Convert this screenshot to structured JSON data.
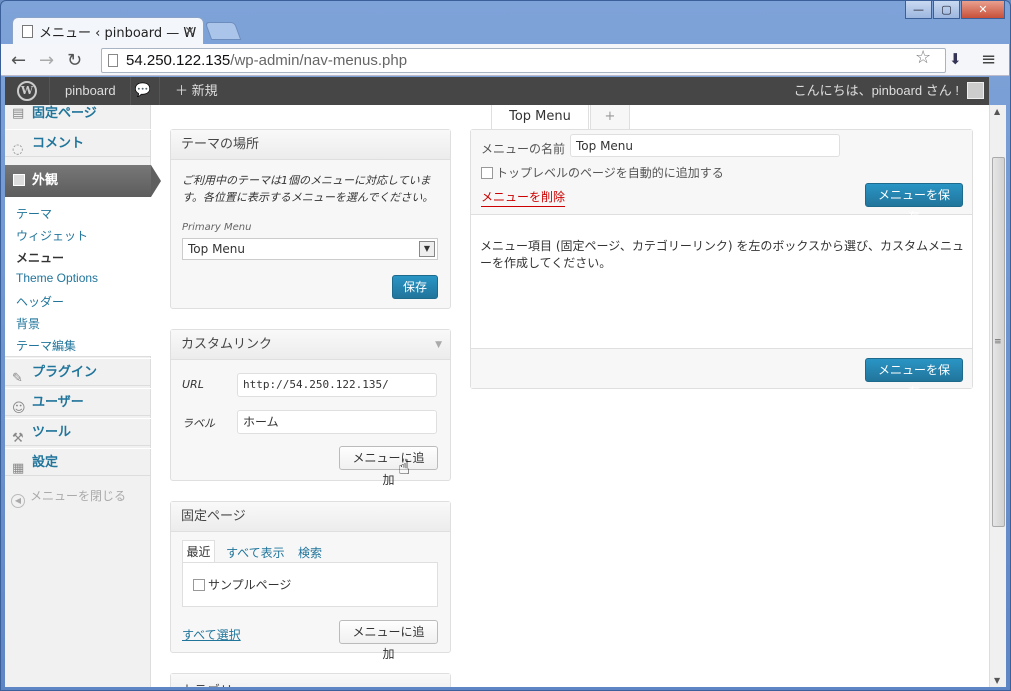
{
  "browser": {
    "tab_title": "メニュー ‹ pinboard — W",
    "url_host": "54.250.122.135",
    "url_path": "/wp-admin/nav-menus.php",
    "window_buttons": [
      "—",
      "▢",
      "✕"
    ]
  },
  "adminbar": {
    "wp_logo": "W",
    "site": "pinboard",
    "comments_icon": "speech-bubble-icon",
    "new": "＋ 新規",
    "howdy": "こんにちは、pinboard さん !"
  },
  "sidebar": {
    "top_partial": "固定ページ",
    "comments": "コメント",
    "appearance": "外観",
    "sub": [
      "テーマ",
      "ウィジェット",
      "メニュー",
      "Theme Options",
      "ヘッダー",
      "背景",
      "テーマ編集"
    ],
    "plugins": "プラグイン",
    "users": "ユーザー",
    "tools": "ツール",
    "settings": "設定",
    "collapse": "メニューを閉じる"
  },
  "theme_locations": {
    "title": "テーマの場所",
    "desc": "ご利用中のテーマは1個のメニューに対応しています。各位置に表示するメニューを選んでください。",
    "primary_label": "Primary Menu",
    "primary_value": "Top Menu",
    "save": "保存"
  },
  "custom_links": {
    "title": "カスタムリンク",
    "url_label": "URL",
    "url_value": "http://54.250.122.135/",
    "label_label": "ラベル",
    "label_value": "ホーム",
    "add": "メニューに追加"
  },
  "pages": {
    "title": "固定ページ",
    "tabs": [
      "最近",
      "すべて表示",
      "検索"
    ],
    "item": "サンプルページ",
    "select_all": "すべて選択",
    "add": "メニューに追加"
  },
  "next_box_partial": "カテゴリー",
  "menu_editor": {
    "tabs": [
      "Top Menu",
      "+"
    ],
    "name_label": "メニューの名前",
    "name_value": "Top Menu",
    "auto_add": "トップレベルのページを自動的に追加する",
    "delete": "メニューを削除",
    "save": "メニューを保存",
    "instructions": "メニュー項目 (固定ページ、カテゴリーリンク) を左のボックスから選び、カスタムメニューを作成してください。"
  }
}
